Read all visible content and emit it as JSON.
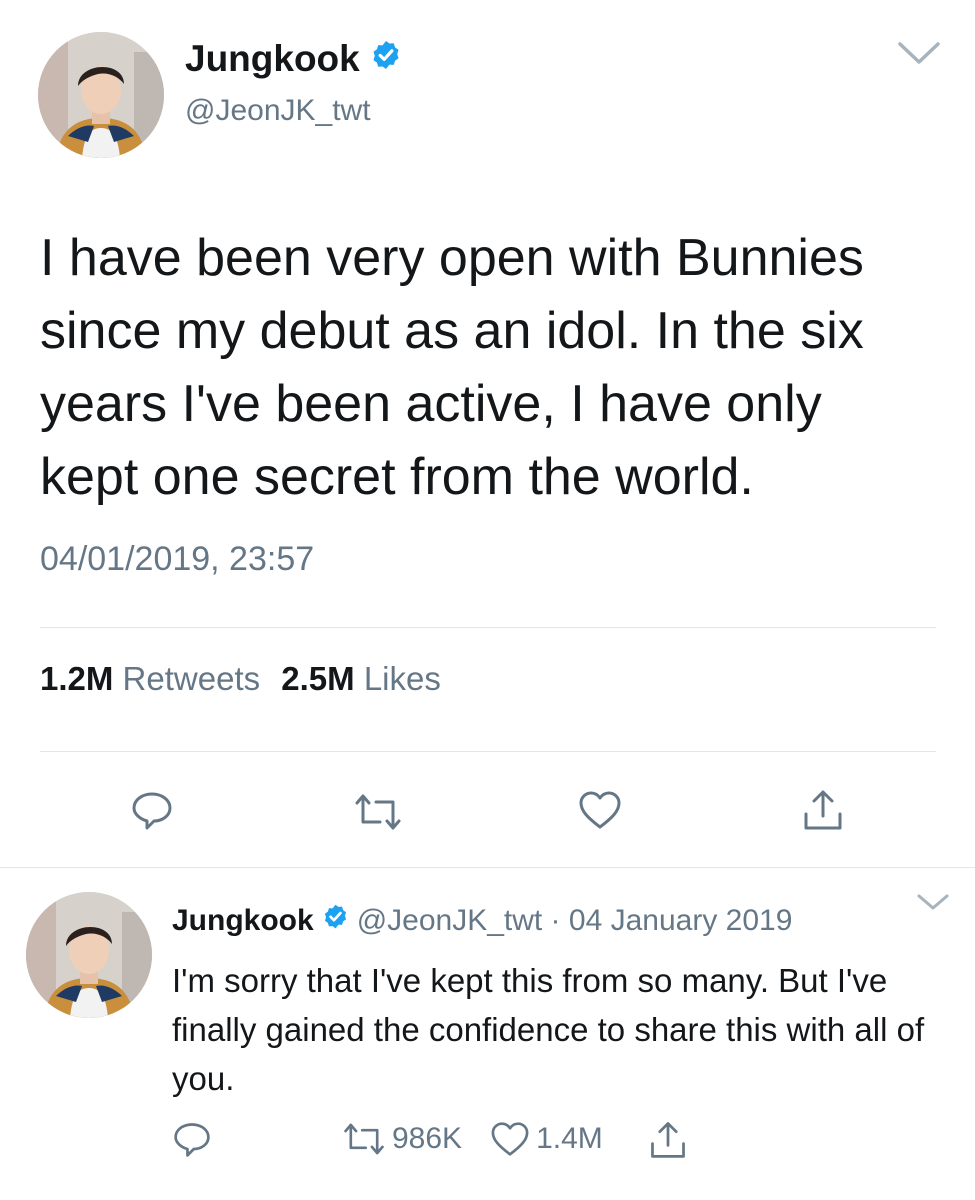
{
  "main_tweet": {
    "display_name": "Jungkook",
    "handle": "@JeonJK_twt",
    "text": "I have been very open with Bunnies since my debut as an idol. In the six years I've been active, I have only kept one secret from the world.",
    "timestamp": "04/01/2019, 23:57",
    "stats": {
      "retweets_count": "1.2M",
      "retweets_label": "Retweets",
      "likes_count": "2.5M",
      "likes_label": "Likes"
    },
    "actions": [
      "reply-icon",
      "retweet-icon",
      "like-icon",
      "share-icon"
    ]
  },
  "reply_tweet": {
    "display_name": "Jungkook",
    "meta": "@JeonJK_twt · 04 January 2019",
    "text": "I'm sorry that I've kept this from so many. But I've finally gained the confidence to share this with all of you.",
    "retweets": "986K",
    "likes": "1.4M"
  },
  "colors": {
    "text": "#14171a",
    "secondary": "#657786",
    "verified": "#1da1f2",
    "divider": "#e1e8ed"
  }
}
